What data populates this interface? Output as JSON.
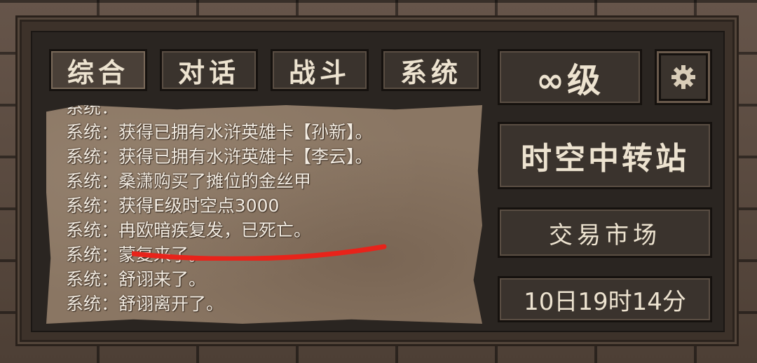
{
  "tabs": [
    {
      "label": "综合"
    },
    {
      "label": "对话"
    },
    {
      "label": "战斗"
    },
    {
      "label": "系统"
    }
  ],
  "level": {
    "label": "∞级"
  },
  "settings": {
    "icon": "gear-icon"
  },
  "location": {
    "label": "时空中转站"
  },
  "market": {
    "label": "交易市场"
  },
  "clock": {
    "label": "10日19时14分"
  },
  "chat_log": [
    "系统：获得已拥有水浒英雄卡【孙新】。",
    "系统：获得已拥有水浒英雄卡【李云】。",
    "系统：桑潇购买了摊位的金丝甲",
    "系统：获得E级时空点3000",
    "系统：冉欧暗疾复发，已死亡。",
    "系统：蒙复来了。",
    "系统：舒诩来了。",
    "系统：舒诩离开了。"
  ],
  "colors": {
    "panel": "#2a2521",
    "button": "#3a332d",
    "parchment": "#8a7663",
    "text": "#ede3d0",
    "annotation": "#e8231a"
  }
}
